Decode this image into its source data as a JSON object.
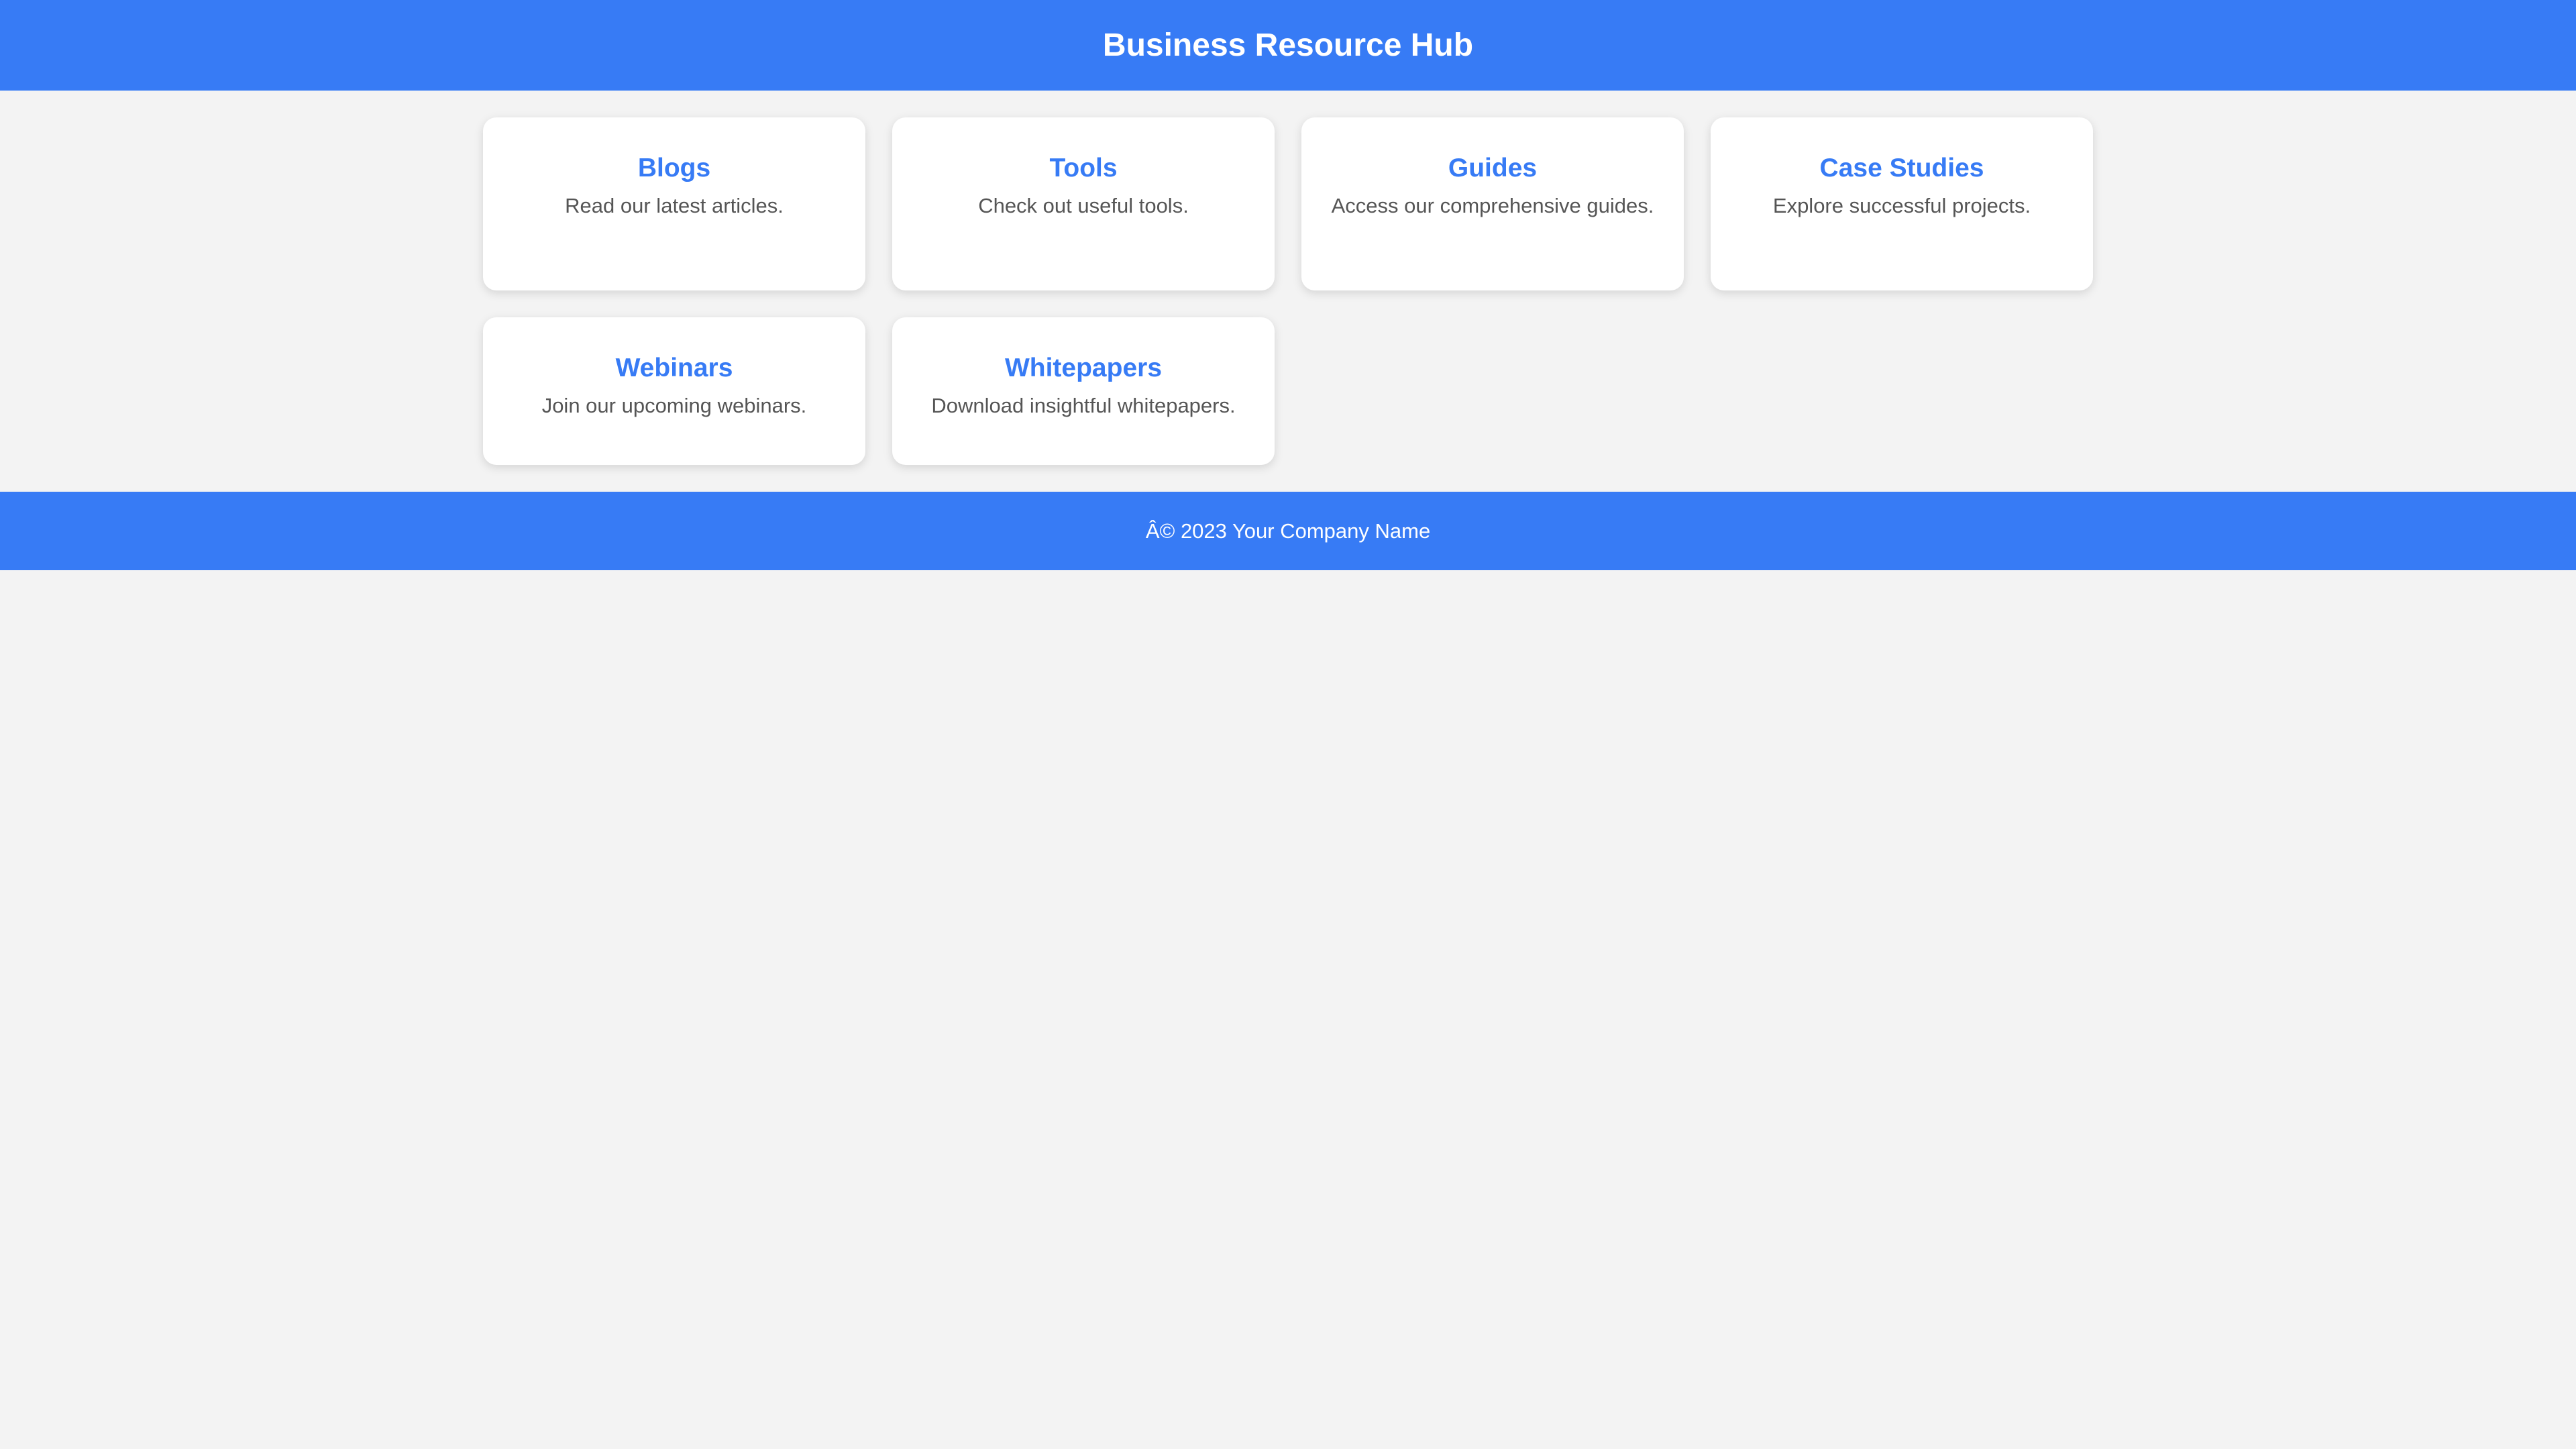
{
  "header": {
    "title": "Business Resource Hub"
  },
  "resources": [
    {
      "title": "Blogs",
      "description": "Read our latest articles."
    },
    {
      "title": "Tools",
      "description": "Check out useful tools."
    },
    {
      "title": "Guides",
      "description": "Access our comprehensive guides."
    },
    {
      "title": "Case Studies",
      "description": "Explore successful projects."
    },
    {
      "title": "Webinars",
      "description": "Join our upcoming webinars."
    },
    {
      "title": "Whitepapers",
      "description": "Download insightful whitepapers."
    }
  ],
  "footer": {
    "text": "Â© 2023 Your Company Name"
  },
  "colors": {
    "header_background": "#377bf5",
    "footer_background": "#377bf5",
    "card_title": "#377bf5",
    "page_background": "#f3f3f3"
  }
}
